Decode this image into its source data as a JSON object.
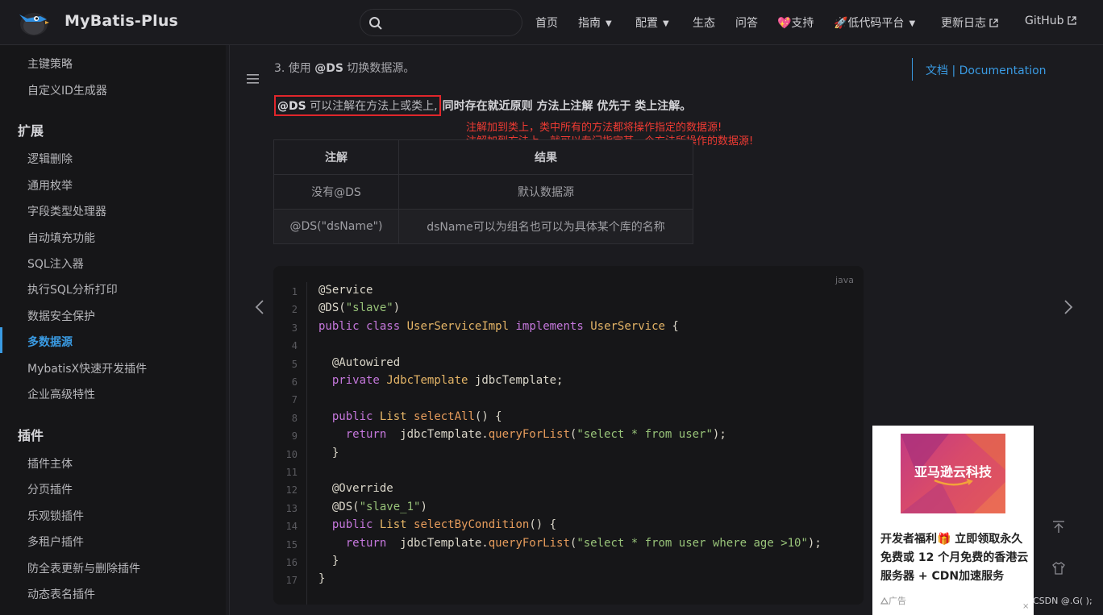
{
  "header": {
    "site_title": "MyBatis-Plus",
    "nav": [
      {
        "label": "首页",
        "dropdown": false,
        "external": false
      },
      {
        "label": "指南",
        "dropdown": true,
        "external": false
      },
      {
        "label": "配置",
        "dropdown": true,
        "external": false
      },
      {
        "label": "生态",
        "dropdown": false,
        "external": false
      },
      {
        "label": "问答",
        "dropdown": false,
        "external": false
      },
      {
        "label": "💖支持",
        "dropdown": false,
        "external": false
      },
      {
        "label": "🚀低代码平台",
        "dropdown": true,
        "external": false
      },
      {
        "label": "更新日志",
        "dropdown": false,
        "external": true
      },
      {
        "label": "GitHub",
        "dropdown": false,
        "external": true
      }
    ]
  },
  "sidebar": {
    "top_items": [
      "主键策略",
      "自定义ID生成器"
    ],
    "groups": [
      {
        "title": "扩展",
        "items": [
          "逻辑删除",
          "通用枚举",
          "字段类型处理器",
          "自动填充功能",
          "SQL注入器",
          "执行SQL分析打印",
          "数据安全保护",
          "多数据源",
          "MybatisX快速开发插件",
          "企业高级特性"
        ]
      },
      {
        "title": "插件",
        "items": [
          "插件主体",
          "分页插件",
          "乐观锁插件",
          "多租户插件",
          "防全表更新与删除插件",
          "动态表名插件"
        ]
      }
    ],
    "active_item": "多数据源"
  },
  "content": {
    "step_prefix": "3. 使用 ",
    "step_code": "@DS",
    "step_suffix": " 切换数据源。",
    "highlight_bold": "@DS",
    "highlight_rest": " 可以注解在方法上或类上,",
    "rule_text": "同时存在就近原则 方法上注解 优先于 类上注解。",
    "annotations": [
      "注解加到类上，类中所有的方法都将操作指定的数据源!",
      "注解加到方法上，就可以专门指定某一个方法所操作的数据源!"
    ],
    "table": {
      "headers": [
        "注解",
        "结果"
      ],
      "rows": [
        [
          "没有@DS",
          "默认数据源"
        ],
        [
          "@DS(\"dsName\")",
          "dsName可以为组名也可以为具体某个库的名称"
        ]
      ]
    },
    "code": {
      "language": "java",
      "line_numbers": [
        "1",
        "2",
        "3",
        "4",
        "5",
        "6",
        "7",
        "8",
        "9",
        "10",
        "11",
        "12",
        "13",
        "14",
        "15",
        "16",
        "17"
      ],
      "lines": [
        "@Service",
        "@DS(\"slave\")",
        "public class UserServiceImpl implements UserService {",
        "",
        "  @Autowired",
        "  private JdbcTemplate jdbcTemplate;",
        "",
        "  public List selectAll() {",
        "    return  jdbcTemplate.queryForList(\"select * from user\");",
        "  }",
        "",
        "  @Override",
        "  @DS(\"slave_1\")",
        "  public List selectByCondition() {",
        "    return  jdbcTemplate.queryForList(\"select * from user where age >10\");",
        "  }",
        "}"
      ]
    }
  },
  "toc": {
    "link": "文档 | Documentation"
  },
  "ad": {
    "banner_text": "亚马逊云科技",
    "text": "开发者福利🎁 立即领取永久免费或 12 个月免费的香港云服务器 + CDN加速服务",
    "tag": "广告",
    "close": "×"
  },
  "watermark": "CSDN @.G( );"
}
